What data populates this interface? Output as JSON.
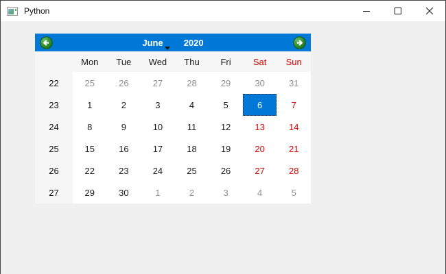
{
  "window": {
    "title": "Python",
    "controls": {
      "minimize_icon": "minimize",
      "maximize_icon": "maximize",
      "close_icon": "close"
    }
  },
  "calendar": {
    "month": "June",
    "year": "2020",
    "nav_prev_icon": "arrow-left-circle",
    "nav_next_icon": "arrow-right-circle",
    "month_dropdown_icon": "chevron-down",
    "day_headers": [
      {
        "label": "Mon",
        "weekend": false
      },
      {
        "label": "Tue",
        "weekend": false
      },
      {
        "label": "Wed",
        "weekend": false
      },
      {
        "label": "Thu",
        "weekend": false
      },
      {
        "label": "Fri",
        "weekend": false
      },
      {
        "label": "Sat",
        "weekend": true
      },
      {
        "label": "Sun",
        "weekend": true
      }
    ],
    "weeks": [
      {
        "week": "22",
        "days": [
          {
            "d": "25",
            "type": "other"
          },
          {
            "d": "26",
            "type": "other"
          },
          {
            "d": "27",
            "type": "other"
          },
          {
            "d": "28",
            "type": "other"
          },
          {
            "d": "29",
            "type": "other"
          },
          {
            "d": "30",
            "type": "other"
          },
          {
            "d": "31",
            "type": "other"
          }
        ]
      },
      {
        "week": "23",
        "days": [
          {
            "d": "1",
            "type": "day"
          },
          {
            "d": "2",
            "type": "day"
          },
          {
            "d": "3",
            "type": "day"
          },
          {
            "d": "4",
            "type": "day"
          },
          {
            "d": "5",
            "type": "day"
          },
          {
            "d": "6",
            "type": "selected"
          },
          {
            "d": "7",
            "type": "weekend"
          }
        ]
      },
      {
        "week": "24",
        "days": [
          {
            "d": "8",
            "type": "day"
          },
          {
            "d": "9",
            "type": "day"
          },
          {
            "d": "10",
            "type": "day"
          },
          {
            "d": "11",
            "type": "day"
          },
          {
            "d": "12",
            "type": "day"
          },
          {
            "d": "13",
            "type": "weekend"
          },
          {
            "d": "14",
            "type": "weekend"
          }
        ]
      },
      {
        "week": "25",
        "days": [
          {
            "d": "15",
            "type": "day"
          },
          {
            "d": "16",
            "type": "day"
          },
          {
            "d": "17",
            "type": "day"
          },
          {
            "d": "18",
            "type": "day"
          },
          {
            "d": "19",
            "type": "day"
          },
          {
            "d": "20",
            "type": "weekend"
          },
          {
            "d": "21",
            "type": "weekend"
          }
        ]
      },
      {
        "week": "26",
        "days": [
          {
            "d": "22",
            "type": "day"
          },
          {
            "d": "23",
            "type": "day"
          },
          {
            "d": "24",
            "type": "day"
          },
          {
            "d": "25",
            "type": "day"
          },
          {
            "d": "26",
            "type": "day"
          },
          {
            "d": "27",
            "type": "weekend"
          },
          {
            "d": "28",
            "type": "weekend"
          }
        ]
      },
      {
        "week": "27",
        "days": [
          {
            "d": "29",
            "type": "day"
          },
          {
            "d": "30",
            "type": "day"
          },
          {
            "d": "1",
            "type": "other"
          },
          {
            "d": "2",
            "type": "other"
          },
          {
            "d": "3",
            "type": "other"
          },
          {
            "d": "4",
            "type": "other"
          },
          {
            "d": "5",
            "type": "other"
          }
        ]
      }
    ],
    "selected_day": "6",
    "colors": {
      "nav_bar_bg": "#0078d7",
      "selected_bg": "#0078d7",
      "weekend_text": "#d60000",
      "other_month_text": "#8f8f8f",
      "nav_button_green": "#2f8f2f"
    }
  }
}
